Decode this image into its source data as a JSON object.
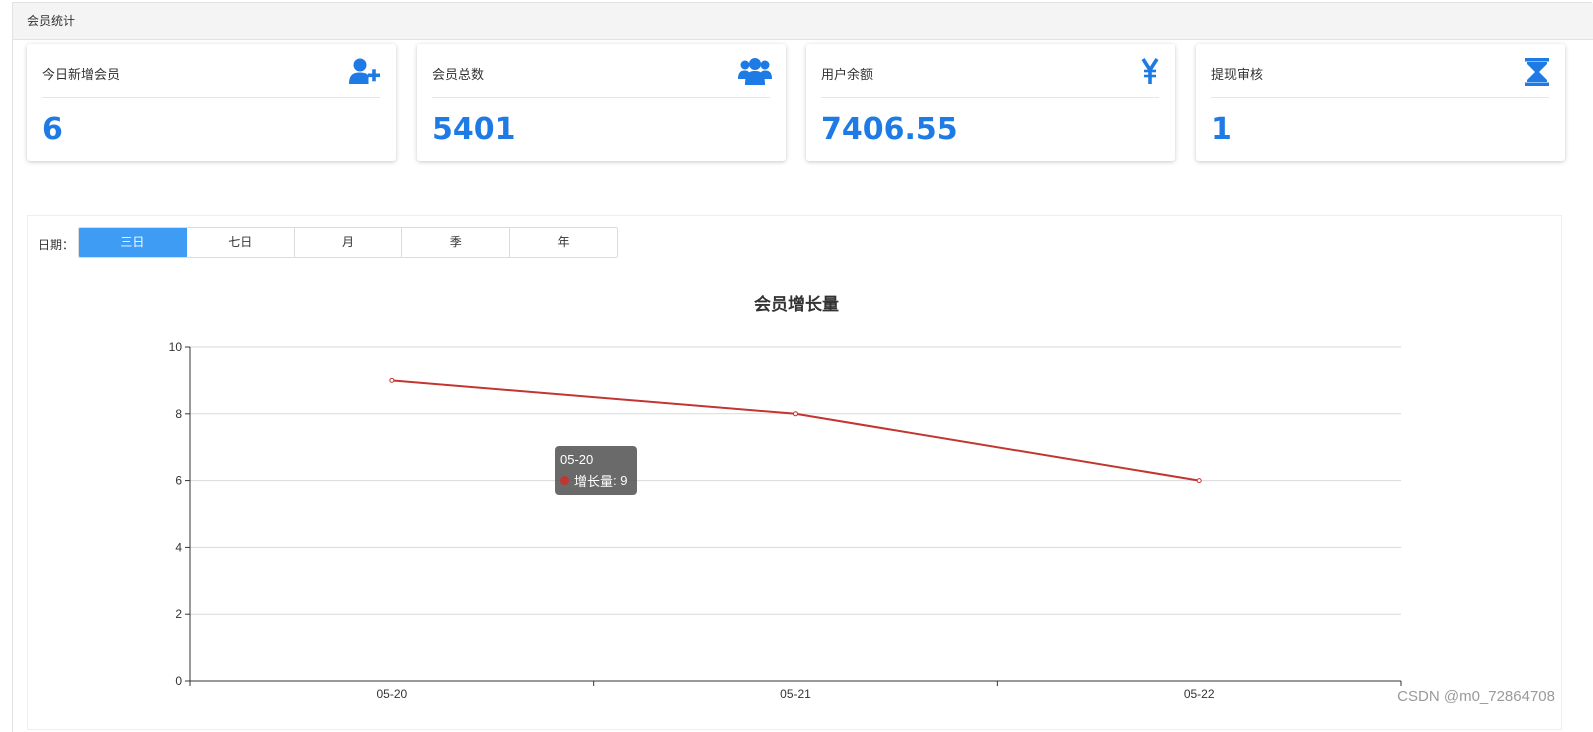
{
  "header": {
    "title": "会员统计"
  },
  "cards": [
    {
      "label": "今日新增会员",
      "value": "6",
      "icon": "user-plus-icon"
    },
    {
      "label": "会员总数",
      "value": "5401",
      "icon": "users-icon"
    },
    {
      "label": "用户余额",
      "value": "7406.55",
      "icon": "yen-icon"
    },
    {
      "label": "提现审核",
      "value": "1",
      "icon": "hourglass-icon"
    }
  ],
  "filter": {
    "label": "日期：",
    "options": [
      "三日",
      "七日",
      "月",
      "季",
      "年"
    ],
    "selected": "三日"
  },
  "tooltip": {
    "category": "05-20",
    "series": "增长量",
    "value": "9"
  },
  "watermark": "CSDN @m0_72864708",
  "colors": {
    "accent": "#1e7be6",
    "active_button": "#3e9cf5",
    "line": "#c23531"
  },
  "chart_data": {
    "type": "line",
    "title": "会员增长量",
    "categories": [
      "05-20",
      "05-21",
      "05-22"
    ],
    "series": [
      {
        "name": "增长量",
        "values": [
          9,
          8,
          6
        ]
      }
    ],
    "ylim": [
      0,
      10
    ],
    "yticks": [
      0,
      2,
      4,
      6,
      8,
      10
    ],
    "grid": true
  }
}
